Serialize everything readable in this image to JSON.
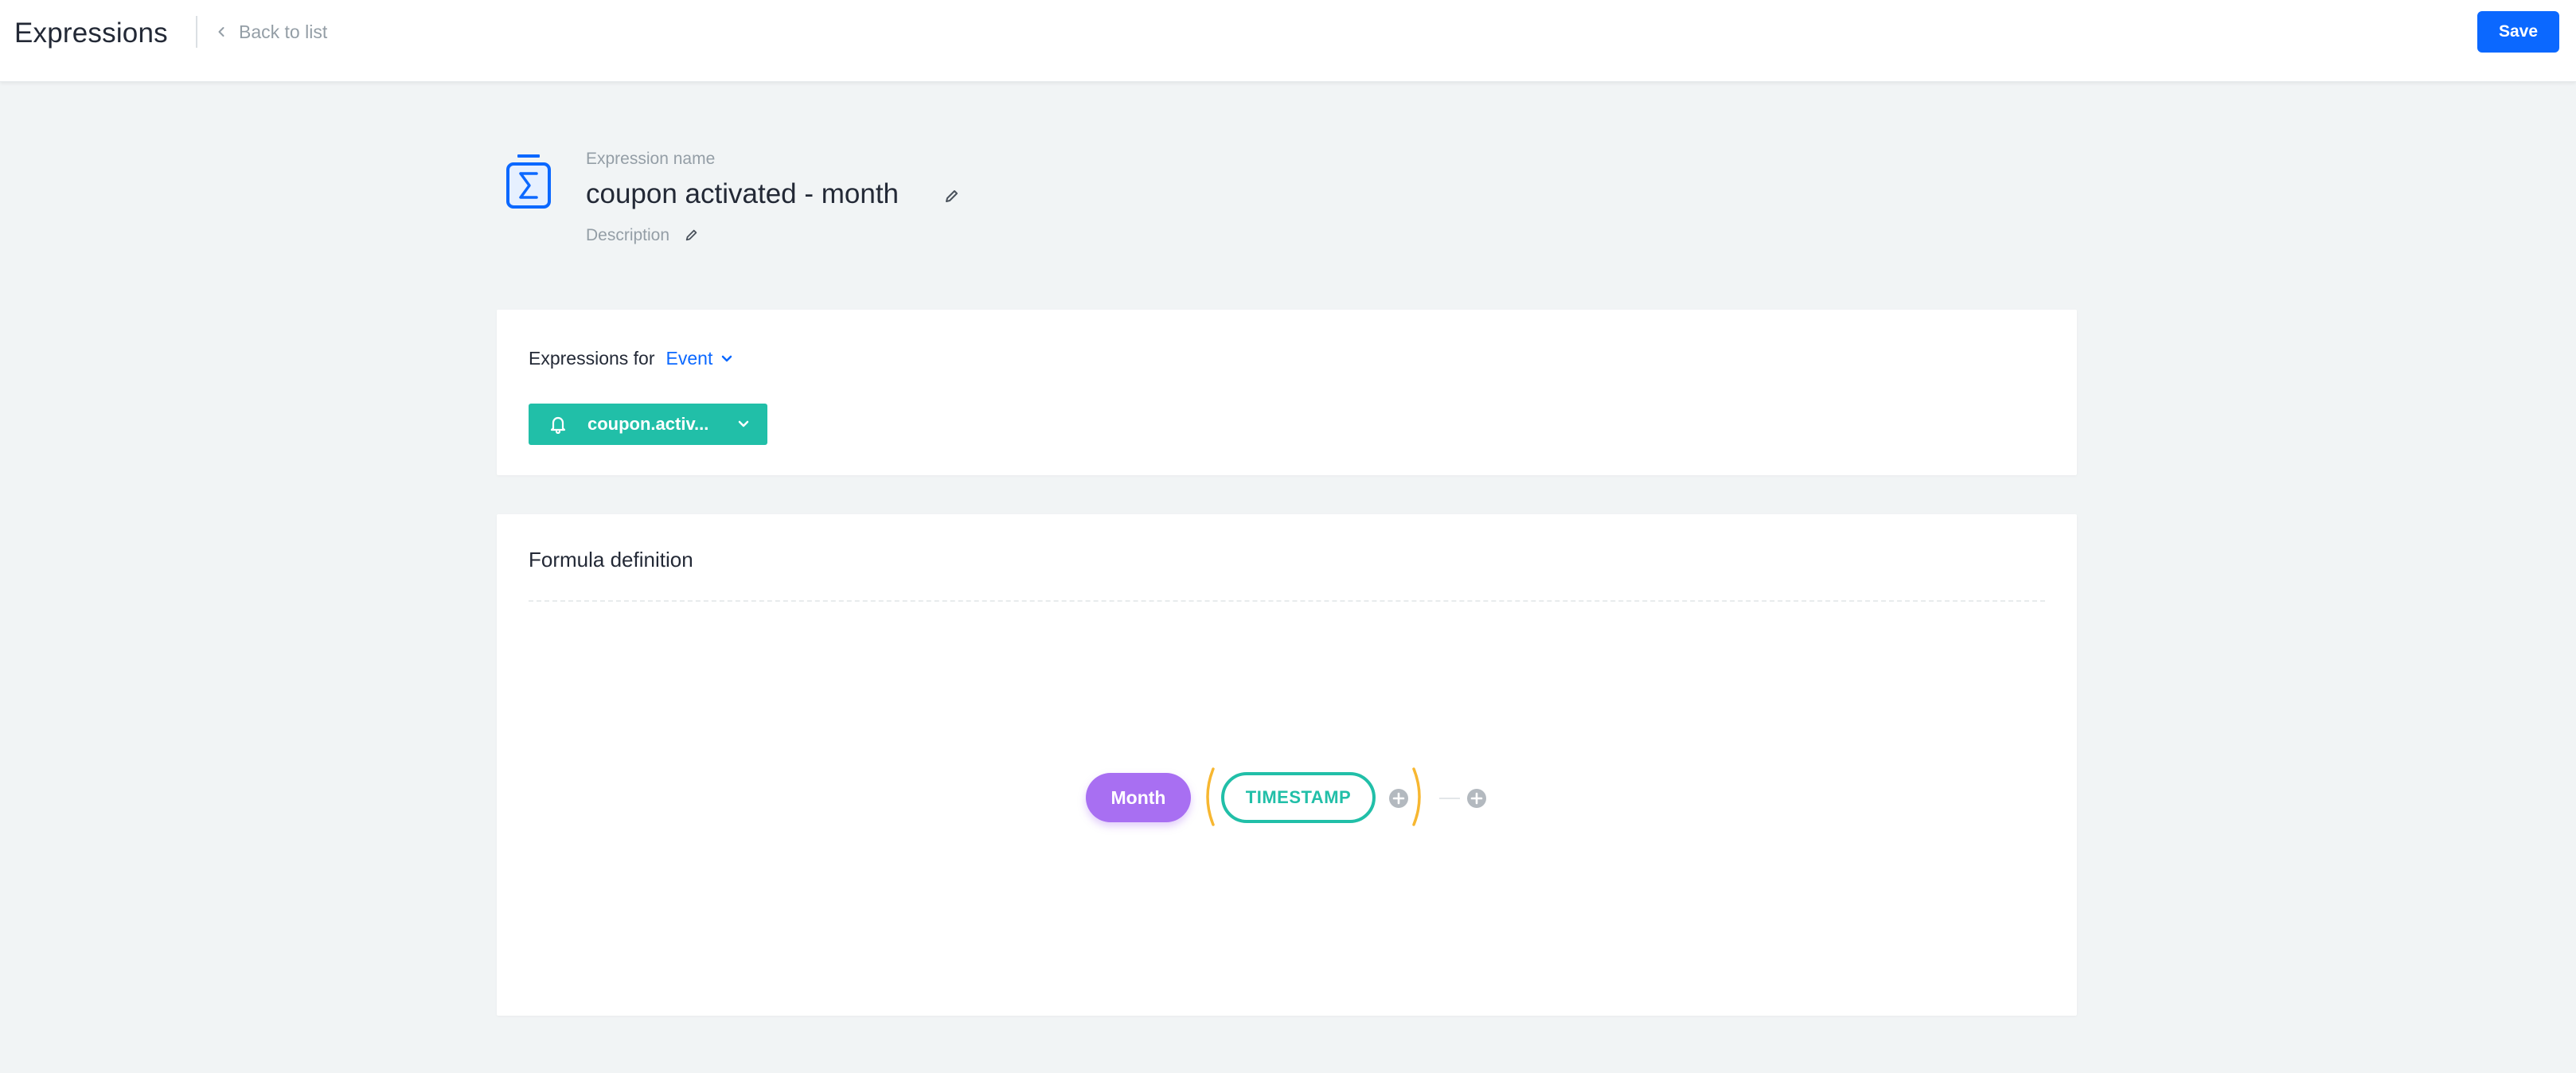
{
  "topbar": {
    "title": "Expressions",
    "back_label": "Back to list",
    "save_label": "Save"
  },
  "expression": {
    "name_label": "Expression name",
    "name": "coupon activated - month",
    "description_label": "Description"
  },
  "event_card": {
    "expressions_for_label": "Expressions for",
    "expressions_for_value": "Event",
    "event_name": "coupon.activ..."
  },
  "formula": {
    "title": "Formula definition",
    "function_label": "Month",
    "argument_label": "TIMESTAMP"
  },
  "colors": {
    "primary": "#0b68ff",
    "teal": "#21bfa8",
    "purple": "#a86ff2",
    "paren": "#f7b731",
    "background": "#f1f4f5"
  },
  "icons": {
    "back": "chevron-left-icon",
    "expression": "sigma-icon",
    "edit": "pencil-icon",
    "dropdown": "chevron-down-icon",
    "event": "bell-icon",
    "add": "plus-circle-icon"
  }
}
